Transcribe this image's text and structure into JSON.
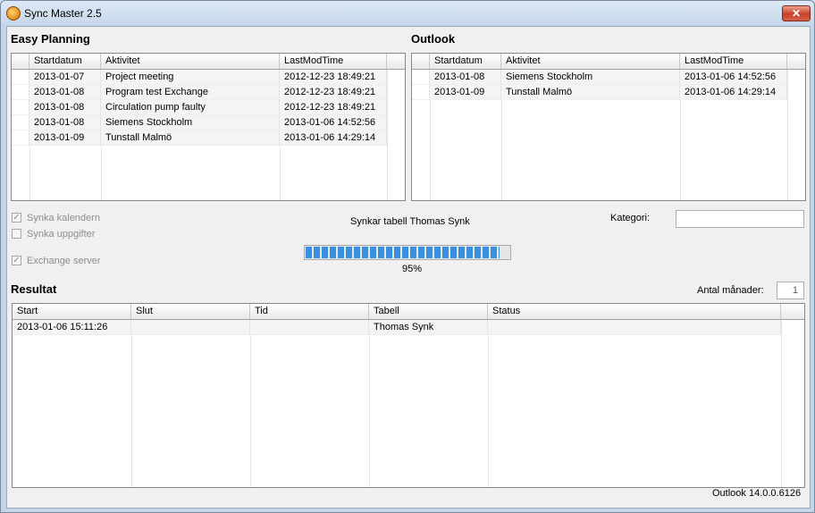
{
  "window": {
    "title": "Sync Master 2.5",
    "close_glyph": "✕"
  },
  "easy_planning": {
    "title": "Easy Planning",
    "columns": [
      "Startdatum",
      "Aktivitet",
      "LastModTime"
    ],
    "rows": [
      [
        "2013-01-07",
        "Project meeting",
        "2012-12-23 18:49:21"
      ],
      [
        "2013-01-08",
        "Program test Exchange",
        "2012-12-23 18:49:21"
      ],
      [
        "2013-01-08",
        "Circulation pump faulty",
        "2012-12-23 18:49:21"
      ],
      [
        "2013-01-08",
        "Siemens Stockholm",
        "2013-01-06 14:52:56"
      ],
      [
        "2013-01-09",
        "Tunstall Malmö",
        "2013-01-06 14:29:14"
      ]
    ]
  },
  "outlook": {
    "title": "Outlook",
    "columns": [
      "Startdatum",
      "Aktivitet",
      "LastModTime"
    ],
    "rows": [
      [
        "2013-01-08",
        "Siemens Stockholm",
        "2013-01-06 14:52:56"
      ],
      [
        "2013-01-09",
        "Tunstall Malmö",
        "2013-01-06 14:29:14"
      ]
    ]
  },
  "options": {
    "sync_calendar": {
      "label": "Synka kalendern",
      "checked": true
    },
    "sync_tasks": {
      "label": "Synka uppgifter",
      "checked": false
    },
    "exchange_server": {
      "label": "Exchange server",
      "checked": true
    },
    "check_glyph": "✓"
  },
  "sync_status": "Synkar tabell Thomas Synk",
  "progress": {
    "value": 95,
    "text": "95%"
  },
  "kategori": {
    "label": "Kategori:",
    "value": ""
  },
  "antal_manader": {
    "label": "Antal månader:",
    "value": "1"
  },
  "result": {
    "title": "Resultat",
    "columns": [
      "Start",
      "Slut",
      "Tid",
      "Tabell",
      "Status"
    ],
    "rows": [
      [
        "2013-01-06 15:11:26",
        "",
        "",
        "Thomas Synk",
        ""
      ]
    ]
  },
  "footer": {
    "version": "Outlook 14.0.0.6126"
  }
}
